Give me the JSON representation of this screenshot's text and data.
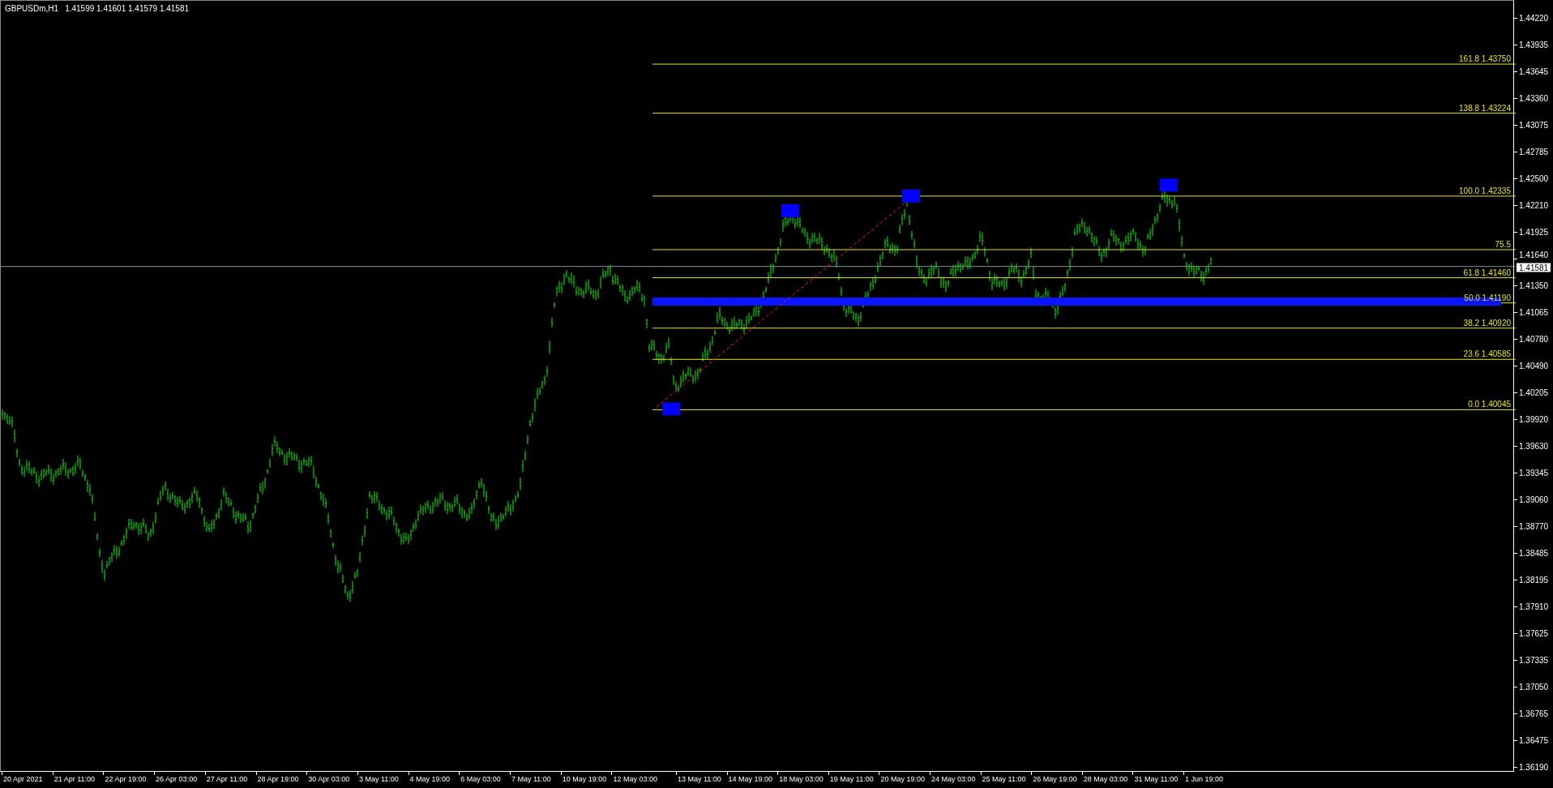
{
  "chart": {
    "symbol": "GBPUSDm,H1",
    "quote": "1.41599 1.41601 1.41579 1.41581"
  },
  "price_axis": [
    "1.44220",
    "1.43935",
    "1.43645",
    "1.43360",
    "1.43075",
    "1.42785",
    "1.42500",
    "1.42210",
    "1.41925",
    "1.41640",
    "1.41350",
    "1.41065",
    "1.40780",
    "1.40490",
    "1.40205",
    "1.39920",
    "1.39630",
    "1.39345",
    "1.39060",
    "1.38770",
    "1.38485",
    "1.38195",
    "1.37910",
    "1.37625",
    "1.37335",
    "1.37050",
    "1.36765",
    "1.36475",
    "1.36190"
  ],
  "current_price": "1.41581",
  "fib_levels": [
    "161.8 1.43750",
    "138.8 1.43224",
    "100.0 1.42335",
    "75.5",
    "61.8 1.41460",
    "50.0 1.41190",
    "38.2 1.40920",
    "23.6 1.40585",
    "0.0 1.40045"
  ],
  "time_axis": [
    "20 Apr 2021",
    "21 Apr 11:00",
    "22 Apr 19:00",
    "26 Apr 03:00",
    "27 Apr 11:00",
    "28 Apr 19:00",
    "30 Apr 03:00",
    "3 May 11:00",
    "4 May 19:00",
    "6 May 03:00",
    "7 May 11:00",
    "10 May 19:00",
    "12 May 03:00",
    "13 May 11:00",
    "14 May 19:00",
    "18 May 03:00",
    "19 May 11:00",
    "20 May 19:00",
    "24 May 03:00",
    "25 May 11:00",
    "26 May 19:00",
    "28 May 03:00",
    "31 May 11:00",
    "1 Jun 19:00"
  ]
}
